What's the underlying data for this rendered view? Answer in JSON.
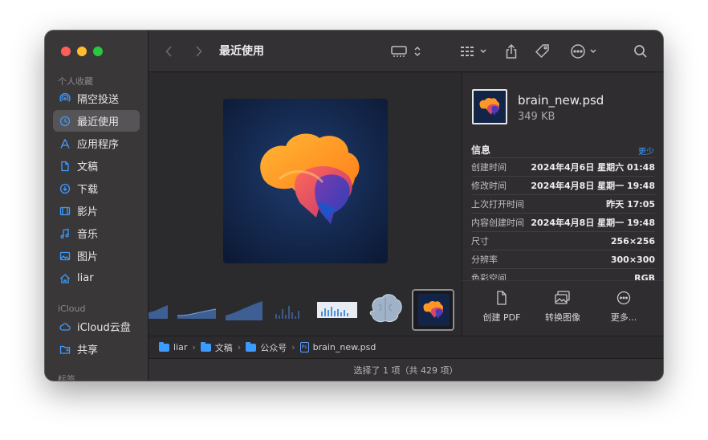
{
  "toolbar": {
    "title": "最近使用",
    "back_icon": "chevron-left-icon",
    "forward_icon": "chevron-right-icon"
  },
  "sidebar": {
    "favorites_header": "个人收藏",
    "items": [
      {
        "label": "隔空投送",
        "icon": "airdrop-icon"
      },
      {
        "label": "最近使用",
        "icon": "clock-icon"
      },
      {
        "label": "应用程序",
        "icon": "apps-icon"
      },
      {
        "label": "文稿",
        "icon": "document-icon"
      },
      {
        "label": "下载",
        "icon": "download-icon"
      },
      {
        "label": "影片",
        "icon": "film-icon"
      },
      {
        "label": "音乐",
        "icon": "music-icon"
      },
      {
        "label": "图片",
        "icon": "photo-icon"
      },
      {
        "label": "liar",
        "icon": "home-icon"
      }
    ],
    "icloud_header": "iCloud",
    "icloud_items": [
      {
        "label": "iCloud云盘",
        "icon": "cloud-icon"
      },
      {
        "label": "共享",
        "icon": "shared-folder-icon"
      }
    ],
    "tags_header": "标签"
  },
  "inspector": {
    "file_name": "brain_new.psd",
    "file_size": "349 KB",
    "info_title": "信息",
    "more_link": "更少",
    "rows": [
      {
        "key": "创建时间",
        "value": "2024年4月6日 星期六 01:48"
      },
      {
        "key": "修改时间",
        "value": "2024年4月8日 星期一 19:48"
      },
      {
        "key": "上次打开时间",
        "value": "昨天 17:05"
      },
      {
        "key": "内容创建时间",
        "value": "2024年4月8日 星期一 19:48"
      },
      {
        "key": "尺寸",
        "value": "256×256"
      },
      {
        "key": "分辨率",
        "value": "300×300"
      },
      {
        "key": "色彩空间",
        "value": "RGB"
      }
    ]
  },
  "actions": [
    {
      "label": "创建 PDF",
      "icon": "pdf-icon"
    },
    {
      "label": "转换图像",
      "icon": "convert-image-icon"
    },
    {
      "label": "更多...",
      "icon": "more-icon"
    }
  ],
  "pathbar": {
    "crumbs": [
      "liar",
      "文稿",
      "公众号",
      "brain_new.psd"
    ],
    "file_badge": "Ps"
  },
  "status": {
    "text": "选择了 1 项（共 429 项）"
  },
  "colors": {
    "accent": "#3b9bff",
    "close": "#fe5f57",
    "minimize": "#febc2e",
    "maximize": "#28c840"
  }
}
